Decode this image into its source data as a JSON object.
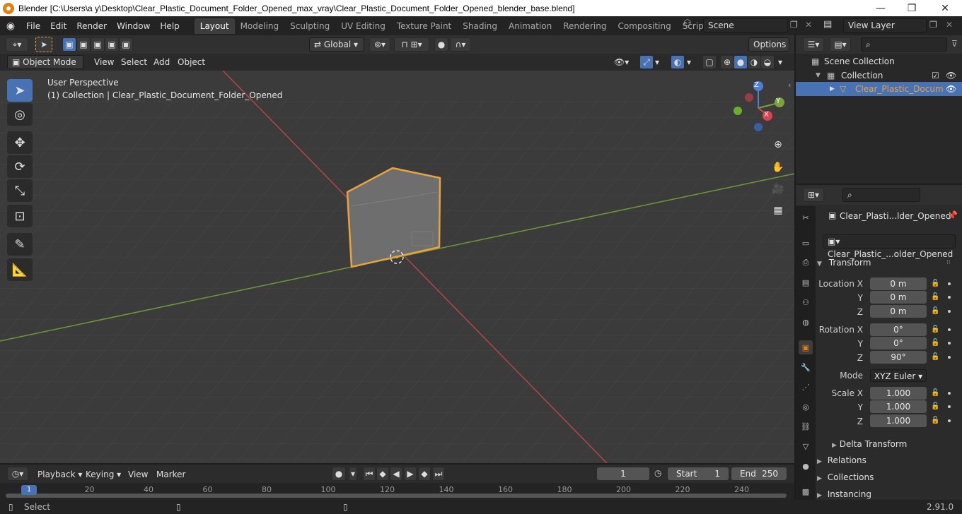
{
  "window": {
    "title": "Blender [C:\\Users\\a y\\Desktop\\Clear_Plastic_Document_Folder_Opened_max_vray\\Clear_Plastic_Document_Folder_Opened_blender_base.blend]",
    "minimize": "—",
    "maximize": "❐",
    "close": "✕"
  },
  "menu": [
    "File",
    "Edit",
    "Render",
    "Window",
    "Help"
  ],
  "workspaces": [
    "Layout",
    "Modeling",
    "Sculpting",
    "UV Editing",
    "Texture Paint",
    "Shading",
    "Animation",
    "Rendering",
    "Compositing",
    "Scripting"
  ],
  "active_workspace": "Layout",
  "add_workspace": "+",
  "scene": {
    "label": "Scene"
  },
  "view_layer": {
    "label": "View Layer"
  },
  "toolbar": {
    "orientation": "Global",
    "options": "Options"
  },
  "viewport_header": {
    "mode": "Object Mode",
    "items": [
      "View",
      "Select",
      "Add",
      "Object"
    ]
  },
  "viewport": {
    "perspective": "User Perspective",
    "collection_info": "(1) Collection | Clear_Plastic_Document_Folder_Opened",
    "gizmo": {
      "z": "Z",
      "y": "Y",
      "x": "X"
    }
  },
  "outliner": {
    "scene_collection": "Scene Collection",
    "collection": "Collection",
    "object": "Clear_Plastic_Docum"
  },
  "properties": {
    "object_name": "Clear_Plasti...lder_Opened",
    "data_name": "Clear_Plastic_...older_Opened",
    "transform_title": "Transform",
    "location_label": "Location X",
    "rotation_label": "Rotation X",
    "scale_label": "Scale X",
    "axis_y": "Y",
    "axis_z": "Z",
    "location": [
      "0 m",
      "0 m",
      "0 m"
    ],
    "rotation": [
      "0°",
      "0°",
      "90°"
    ],
    "mode_label": "Mode",
    "mode_value": "XYZ Euler",
    "scale": [
      "1.000",
      "1.000",
      "1.000"
    ],
    "delta_transform": "Delta Transform",
    "relations": "Relations",
    "collections": "Collections",
    "instancing": "Instancing"
  },
  "timeline": {
    "menus": [
      "Playback",
      "Keying",
      "View",
      "Marker"
    ],
    "current_frame": "1",
    "start_label": "Start",
    "start": "1",
    "end_label": "End",
    "end": "250",
    "ticks": [
      "1",
      "20",
      "40",
      "60",
      "80",
      "100",
      "120",
      "140",
      "160",
      "180",
      "200",
      "220",
      "240"
    ]
  },
  "status": {
    "left": "Select",
    "version": "2.91.0"
  },
  "colors": {
    "accent": "#4772b3",
    "selection_outline": "#e8a33c",
    "x_axis": "#c94a4a",
    "y_axis": "#7aa33a"
  }
}
